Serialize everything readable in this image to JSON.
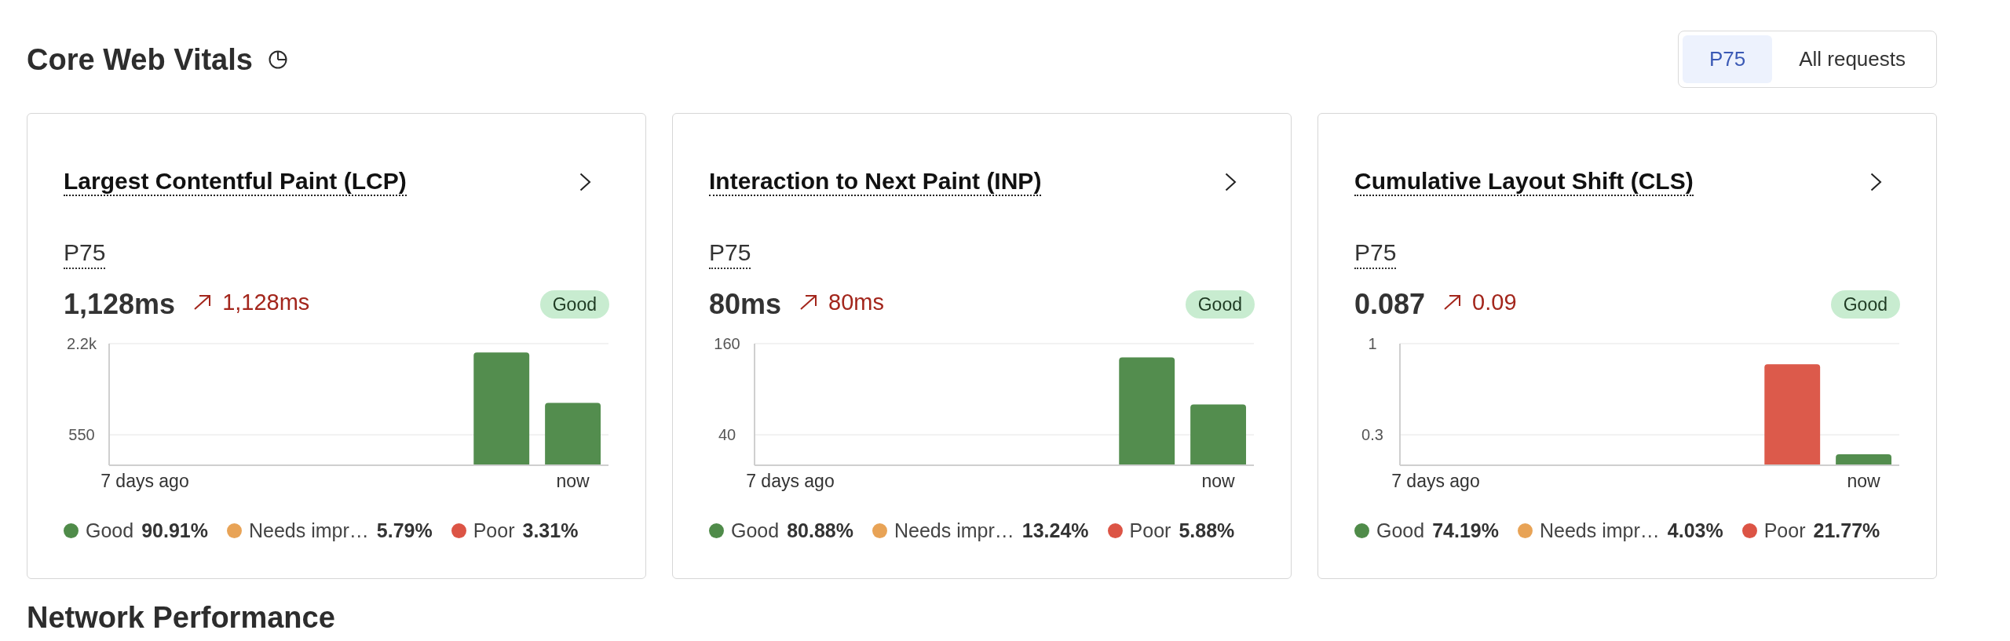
{
  "section": {
    "title": "Core Web Vitals"
  },
  "view_toggle": [
    {
      "label": "P75",
      "selected": true
    },
    {
      "label": "All requests",
      "selected": false
    }
  ],
  "cards": [
    {
      "title": "Largest Contentful Paint (LCP)",
      "percentile": "P75",
      "value": "1,128ms",
      "trend": {
        "value": "1,128ms"
      },
      "badge": {
        "label": "Good",
        "kind": "good"
      },
      "chart_data": {
        "type": "bar",
        "categories": [
          "7 days ago",
          null,
          null,
          null,
          null,
          null,
          "now"
        ],
        "series": [
          {
            "color": "#538d4e",
            "values": [
              null,
              null,
              null,
              null,
              null,
              2040,
              1130
            ]
          }
        ],
        "ylim": [
          0,
          2200
        ],
        "yticks": [
          {
            "value": 550,
            "label": "550"
          },
          {
            "value": 2200,
            "label": "2.2k"
          }
        ]
      },
      "legend": [
        {
          "label": "Good",
          "value": "90.91%",
          "color": "#4f8b49"
        },
        {
          "label": "Needs impr…",
          "value": "5.79%",
          "color": "#e8a356"
        },
        {
          "label": "Poor",
          "value": "3.31%",
          "color": "#dc5445"
        }
      ]
    },
    {
      "title": "Interaction to Next Paint (INP)",
      "percentile": "P75",
      "value": "80ms",
      "trend": {
        "value": "80ms"
      },
      "badge": {
        "label": "Good",
        "kind": "good"
      },
      "chart_data": {
        "type": "bar",
        "categories": [
          "7 days ago",
          null,
          null,
          null,
          null,
          null,
          "now"
        ],
        "series": [
          {
            "color": "#538d4e",
            "values": [
              null,
              null,
              null,
              null,
              null,
              142,
              80
            ]
          }
        ],
        "ylim": [
          0,
          160
        ],
        "yticks": [
          {
            "value": 40,
            "label": "40"
          },
          {
            "value": 160,
            "label": "160"
          }
        ]
      },
      "legend": [
        {
          "label": "Good",
          "value": "80.88%",
          "color": "#4f8b49"
        },
        {
          "label": "Needs impr…",
          "value": "13.24%",
          "color": "#e8a356"
        },
        {
          "label": "Poor",
          "value": "5.88%",
          "color": "#dc5445"
        }
      ]
    },
    {
      "title": "Cumulative Layout Shift (CLS)",
      "percentile": "P75",
      "value": "0.087",
      "trend": {
        "value": "0.09"
      },
      "badge": {
        "label": "Good",
        "kind": "good"
      },
      "chart_data": {
        "type": "bar",
        "categories": [
          "7 days ago",
          null,
          null,
          null,
          null,
          null,
          "now"
        ],
        "series": [
          {
            "color": "#538d4e",
            "values": [
              null,
              null,
              null,
              null,
              null,
              null,
              0.09
            ]
          },
          {
            "color": "#dc5a4b",
            "values": [
              null,
              null,
              null,
              null,
              null,
              0.83,
              null
            ]
          }
        ],
        "ylim": [
          0,
          1
        ],
        "yticks": [
          {
            "value": 0.25,
            "label": "0.3"
          },
          {
            "value": 1,
            "label": "1"
          }
        ]
      },
      "legend": [
        {
          "label": "Good",
          "value": "74.19%",
          "color": "#4f8b49"
        },
        {
          "label": "Needs impr…",
          "value": "4.03%",
          "color": "#e8a356"
        },
        {
          "label": "Poor",
          "value": "21.77%",
          "color": "#dc5445"
        }
      ]
    }
  ],
  "next_section": {
    "title": "Network Performance"
  }
}
